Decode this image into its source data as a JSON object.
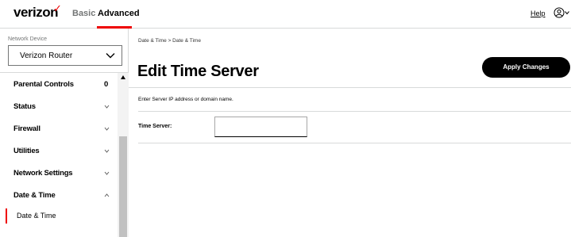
{
  "brand": {
    "logo_text": "verizon",
    "logo_mark": "✓",
    "accent_color": "#ee0000"
  },
  "header": {
    "tabs": [
      {
        "label": "Basic",
        "active": false
      },
      {
        "label": "Advanced",
        "active": true
      }
    ],
    "help_label": "Help",
    "user_icon": "user-circle-icon"
  },
  "sidebar": {
    "device_label": "Network Device",
    "device_value": "Verizon Router",
    "items": [
      {
        "label": "Parental Controls",
        "badge": "0"
      },
      {
        "label": "Status",
        "icon": "chevron-down-icon"
      },
      {
        "label": "Firewall",
        "icon": "chevron-down-icon"
      },
      {
        "label": "Utilities",
        "icon": "chevron-down-icon"
      },
      {
        "label": "Network Settings",
        "icon": "chevron-down-icon"
      },
      {
        "label": "Date & Time",
        "icon": "chevron-up-icon"
      }
    ],
    "sub_items": [
      {
        "label": "Date & Time",
        "active": true
      }
    ]
  },
  "main": {
    "breadcrumb": "Date & Time  >  Date & Time",
    "title": "Edit Time Server",
    "apply_label": "Apply Changes",
    "instruction": "Enter Server IP address or domain name.",
    "field_label": "Time Server:",
    "field_value": "",
    "field_placeholder": ""
  }
}
